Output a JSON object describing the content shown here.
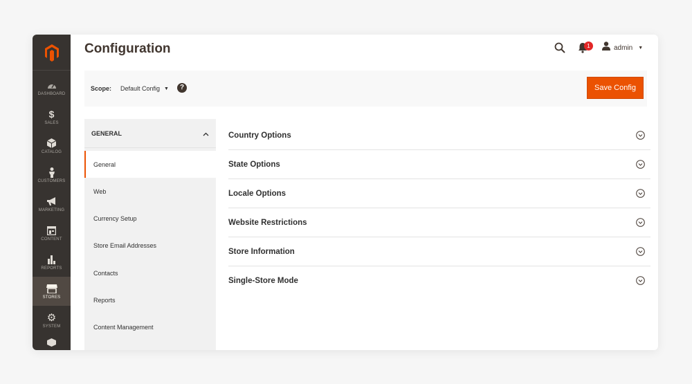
{
  "header": {
    "title": "Configuration",
    "notification_count": "1",
    "user_name": "admin"
  },
  "sidebar": {
    "items": [
      {
        "label": "Dashboard",
        "icon": "dashboard-icon"
      },
      {
        "label": "Sales",
        "icon": "dollar-icon"
      },
      {
        "label": "Catalog",
        "icon": "cube-icon"
      },
      {
        "label": "Customers",
        "icon": "person-icon"
      },
      {
        "label": "Marketing",
        "icon": "megaphone-icon"
      },
      {
        "label": "Content",
        "icon": "content-icon"
      },
      {
        "label": "Reports",
        "icon": "bar-chart-icon"
      },
      {
        "label": "Stores",
        "icon": "store-icon",
        "active": true
      },
      {
        "label": "System",
        "icon": "gear-icon"
      }
    ]
  },
  "scope": {
    "label": "Scope:",
    "value": "Default Config"
  },
  "actions": {
    "save_label": "Save Config"
  },
  "tabs": {
    "group": "General",
    "items": [
      {
        "label": "General",
        "active": true
      },
      {
        "label": "Web"
      },
      {
        "label": "Currency Setup"
      },
      {
        "label": "Store Email Addresses"
      },
      {
        "label": "Contacts"
      },
      {
        "label": "Reports"
      },
      {
        "label": "Content Management"
      }
    ]
  },
  "sections": [
    {
      "title": "Country Options"
    },
    {
      "title": "State Options"
    },
    {
      "title": "Locale Options"
    },
    {
      "title": "Website Restrictions"
    },
    {
      "title": "Store Information"
    },
    {
      "title": "Single-Store Mode"
    }
  ],
  "colors": {
    "sidebar_bg": "#373330",
    "accent": "#eb5202",
    "badge": "#e22626"
  }
}
